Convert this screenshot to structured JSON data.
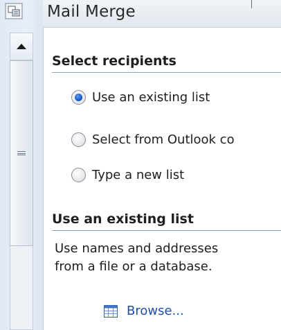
{
  "pane": {
    "title": "Mail Merge"
  },
  "select_recipients": {
    "heading": "Select recipients",
    "options": [
      {
        "label": "Use an existing list",
        "checked": true
      },
      {
        "label": "Select from Outlook co",
        "checked": false
      },
      {
        "label": "Type a new list",
        "checked": false
      }
    ]
  },
  "existing_list": {
    "heading": "Use an existing list",
    "description_line1": "Use names and addresses",
    "description_line2": "from a file or a database.",
    "browse_label": "Browse..."
  },
  "icons": {
    "corner": "pane-options-icon",
    "scroll_up": "triangle-up-icon",
    "thumb_grip": "grip-lines-icon",
    "browse": "table-icon"
  },
  "colors": {
    "link": "#1f4ea3",
    "radio_selected": "#1e5cc9",
    "section_rule": "#8fa3bd",
    "sidebar": "#dfe9f5"
  }
}
